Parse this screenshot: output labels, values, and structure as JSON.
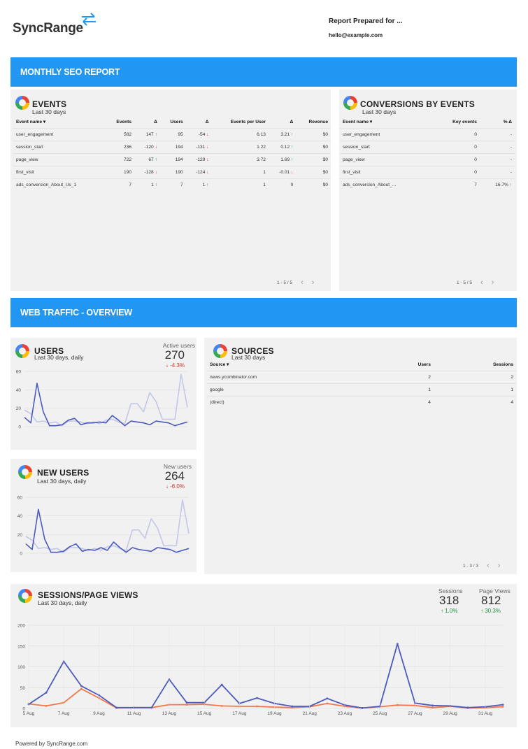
{
  "header": {
    "logo_text": "SyncRange",
    "prepared_for": "Report Prepared for ...",
    "email": "hello@example.com"
  },
  "banners": {
    "monthly": "MONTHLY SEO REPORT",
    "traffic": "WEB TRAFFIC - OVERVIEW"
  },
  "events": {
    "title": "EVENTS",
    "subtitle": "Last 30 days",
    "headers": [
      "Event name ▾",
      "Events",
      "Δ",
      "Users",
      "Δ",
      "Events per User",
      "Δ",
      "Revenue"
    ],
    "rows": [
      {
        "name": "user_engagement",
        "events": "582",
        "d1": "147",
        "d1dir": "up",
        "users": "95",
        "d2": "-54",
        "d2dir": "dn",
        "epu": "6.13",
        "d3": "3.21",
        "d3dir": "up",
        "rev": "$0"
      },
      {
        "name": "session_start",
        "events": "236",
        "d1": "-120",
        "d1dir": "dn",
        "users": "194",
        "d2": "-131",
        "d2dir": "dn",
        "epu": "1.22",
        "d3": "0.12",
        "d3dir": "up",
        "rev": "$0"
      },
      {
        "name": "page_view",
        "events": "722",
        "d1": "67",
        "d1dir": "up",
        "users": "194",
        "d2": "-129",
        "d2dir": "dn",
        "epu": "3.72",
        "d3": "1.69",
        "d3dir": "up",
        "rev": "$0"
      },
      {
        "name": "first_visit",
        "events": "190",
        "d1": "-128",
        "d1dir": "dn",
        "users": "190",
        "d2": "-124",
        "d2dir": "dn",
        "epu": "1",
        "d3": "-0.01",
        "d3dir": "dn",
        "rev": "$0"
      },
      {
        "name": "ads_conversion_About_Us_1",
        "events": "7",
        "d1": "1",
        "d1dir": "up",
        "users": "7",
        "d2": "1",
        "d2dir": "up",
        "epu": "1",
        "d3": "0",
        "d3dir": "",
        "rev": "$0"
      }
    ],
    "pager": "1 - 5 / 5"
  },
  "conversions": {
    "title": "CONVERSIONS BY EVENTS",
    "subtitle": "Last 30 days",
    "headers": [
      "Event name ▾",
      "Key events",
      "% Δ"
    ],
    "rows": [
      {
        "name": "user_engagement",
        "key": "0",
        "pct": "-",
        "dir": ""
      },
      {
        "name": "session_start",
        "key": "0",
        "pct": "-",
        "dir": ""
      },
      {
        "name": "page_view",
        "key": "0",
        "pct": "-",
        "dir": ""
      },
      {
        "name": "first_visit",
        "key": "0",
        "pct": "-",
        "dir": ""
      },
      {
        "name": "ads_conversion_About_...",
        "key": "7",
        "pct": "16.7%",
        "dir": "up"
      }
    ],
    "pager": "1 - 5 / 5"
  },
  "users": {
    "title": "USERS",
    "subtitle": "Last 30 days, daily",
    "metric_label": "Active users",
    "metric_value": "270",
    "metric_delta": "-4.3%",
    "yticks": [
      "60",
      "40",
      "20",
      "0"
    ]
  },
  "new_users": {
    "title": "NEW USERS",
    "subtitle": "Last 30 days, daily",
    "metric_label": "New users",
    "metric_value": "264",
    "metric_delta": "-6.0%",
    "yticks": [
      "60",
      "40",
      "20",
      "0"
    ]
  },
  "sources": {
    "title": "SOURCES",
    "subtitle": "Last 30 days",
    "headers": [
      "Source ▾",
      "Users",
      "Sessions"
    ],
    "rows": [
      {
        "source": "news.ycombinator.com",
        "users": "2",
        "sessions": "2"
      },
      {
        "source": "google",
        "users": "1",
        "sessions": "1"
      },
      {
        "source": "(direct)",
        "users": "4",
        "sessions": "4"
      }
    ],
    "pager": "1 - 3 / 3"
  },
  "sessions": {
    "title": "SESSIONS/PAGE VIEWS",
    "subtitle": "Last 30 days, daily",
    "m1_label": "Sessions",
    "m1_value": "318",
    "m1_delta": "1.0%",
    "m2_label": "Page Views",
    "m2_value": "812",
    "m2_delta": "30.3%",
    "yticks": [
      "200",
      "150",
      "100",
      "50",
      "0"
    ],
    "xticks": [
      "5 Aug",
      "7 Aug",
      "9 Aug",
      "11 Aug",
      "13 Aug",
      "15 Aug",
      "17 Aug",
      "19 Aug",
      "21 Aug",
      "23 Aug",
      "25 Aug",
      "27 Aug",
      "29 Aug",
      "31 Aug"
    ]
  },
  "footer": "Powered by SyncRange.com",
  "colors": {
    "banner": "#2196f3",
    "series_primary": "#4b5bbd",
    "series_compare": "#c3c7e8",
    "series_orange": "#f4774a",
    "positive": "#1e8e3e",
    "negative": "#d93025"
  },
  "chart_data": [
    {
      "type": "line",
      "title": "USERS",
      "ylim": [
        0,
        60
      ],
      "series": [
        {
          "values": [
            10,
            4,
            47,
            16,
            1,
            1,
            2,
            7,
            9,
            2,
            4,
            4,
            5,
            4,
            12,
            7,
            1,
            6,
            5,
            4,
            2,
            6,
            5,
            4,
            1,
            3,
            5
          ]
        },
        {
          "values": [
            18,
            14,
            5,
            6,
            4,
            5,
            1,
            6,
            6,
            5,
            3,
            5,
            3,
            7,
            8,
            5,
            3,
            25,
            25,
            16,
            37,
            27,
            8,
            8,
            8,
            57,
            21
          ]
        }
      ]
    },
    {
      "type": "line",
      "title": "NEW USERS",
      "ylim": [
        0,
        60
      ],
      "series": [
        {
          "values": [
            10,
            4,
            47,
            15,
            1,
            1,
            2,
            7,
            10,
            2,
            4,
            3,
            6,
            3,
            12,
            6,
            1,
            6,
            4,
            3,
            2,
            6,
            5,
            4,
            1,
            3,
            5
          ]
        },
        {
          "values": [
            18,
            14,
            5,
            6,
            4,
            5,
            1,
            6,
            6,
            5,
            3,
            5,
            3,
            7,
            8,
            5,
            3,
            25,
            25,
            16,
            37,
            27,
            8,
            8,
            8,
            57,
            21
          ]
        }
      ]
    },
    {
      "type": "line",
      "title": "SESSIONS/PAGE VIEWS",
      "categories": [
        "5 Aug",
        "6 Aug",
        "7 Aug",
        "8 Aug",
        "9 Aug",
        "10 Aug",
        "11 Aug",
        "12 Aug",
        "13 Aug",
        "14 Aug",
        "15 Aug",
        "16 Aug",
        "17 Aug",
        "18 Aug",
        "19 Aug",
        "20 Aug",
        "21 Aug",
        "22 Aug",
        "23 Aug",
        "24 Aug",
        "25 Aug",
        "26 Aug",
        "27 Aug",
        "28 Aug",
        "29 Aug",
        "30 Aug",
        "31 Aug",
        "1 Sep"
      ],
      "ylim": [
        0,
        200
      ],
      "series": [
        {
          "values": [
            10,
            38,
            113,
            54,
            32,
            2,
            2,
            2,
            70,
            14,
            14,
            57,
            12,
            25,
            12,
            5,
            5,
            24,
            8,
            1,
            5,
            155,
            13,
            7,
            6,
            2,
            4,
            9
          ]
        },
        {
          "values": [
            11,
            6,
            14,
            47,
            25,
            1,
            2,
            2,
            9,
            9,
            10,
            6,
            5,
            5,
            3,
            2,
            4,
            12,
            5,
            1,
            4,
            8,
            7,
            2,
            5,
            1,
            2,
            4
          ]
        }
      ]
    }
  ]
}
